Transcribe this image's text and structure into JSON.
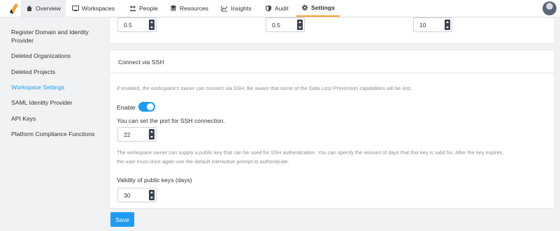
{
  "nav": {
    "tabs": [
      {
        "label": "Overview",
        "icon": "home-icon"
      },
      {
        "label": "Workspaces",
        "icon": "monitor-icon"
      },
      {
        "label": "People",
        "icon": "people-icon"
      },
      {
        "label": "Resources",
        "icon": "database-icon"
      },
      {
        "label": "Insights",
        "icon": "chart-icon"
      },
      {
        "label": "Audit",
        "icon": "shield-icon"
      },
      {
        "label": "Settings",
        "icon": "gear-icon"
      }
    ],
    "active_tab": "Settings",
    "accent_color": "#f5a13a"
  },
  "sidebar": {
    "items": [
      {
        "label": "Register Domain and Identity Provider"
      },
      {
        "label": "Deleted Organizations"
      },
      {
        "label": "Deleted Projects"
      },
      {
        "label": "Workspace Settings"
      },
      {
        "label": "SAML Identity Provider"
      },
      {
        "label": "API Keys"
      },
      {
        "label": "Platform Compliance Functions"
      }
    ],
    "active_item": "Workspace Settings"
  },
  "top_card": {
    "values": [
      "0.5",
      "0.5",
      "10"
    ]
  },
  "ssh": {
    "title": "Connect via SSH",
    "description": "If enabled, the workspace's owner can connect via SSH. Be aware that some of the Data Loss Prevention capabilities will be lost.",
    "enable_label": "Enable",
    "enabled": true,
    "port_label": "You can set the port for SSH connection.",
    "port_value": "22",
    "key_help_line1": "The workspace owner can supply a public key that can be used for SSH authentication. You can specify the amount of days that this key is valid for. After the key expires,",
    "key_help_line2": "the user must once again use the default interactive prompt to authenticate.",
    "validity_label": "Validity of public keys (days)",
    "validity_value": "30"
  },
  "actions": {
    "save_label": "Save"
  },
  "colors": {
    "primary": "#1f9cf0",
    "page_bg": "#f1f2f4"
  }
}
